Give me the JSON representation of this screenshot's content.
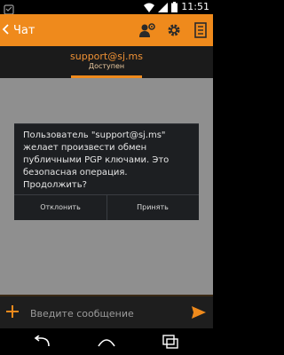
{
  "status_bar": {
    "time": "11:51",
    "left_icon": "android-debug-icon",
    "right_icons": [
      "wifi-icon",
      "signal-icon",
      "battery-icon"
    ]
  },
  "app_bar": {
    "title": "Чат",
    "back_icon": "chevron-left-icon",
    "actions": [
      "user-settings-icon",
      "gear-icon",
      "document-icon"
    ],
    "color": "#ef8a1c"
  },
  "contact": {
    "name": "support@sj.ms",
    "status": "Доступен"
  },
  "dialog": {
    "message": "Пользователь \"support@sj.ms\" желает произвести обмен публичными PGP ключами. Это безопасная операция. Продолжить?",
    "negative_label": "Отклонить",
    "positive_label": "Принять"
  },
  "composer": {
    "placeholder": "Введите сообщение",
    "value": "",
    "add_icon": "plus-icon",
    "send_icon": "send-icon"
  },
  "nav_bar": {
    "buttons": [
      "back-icon",
      "home-icon",
      "recents-icon"
    ]
  }
}
